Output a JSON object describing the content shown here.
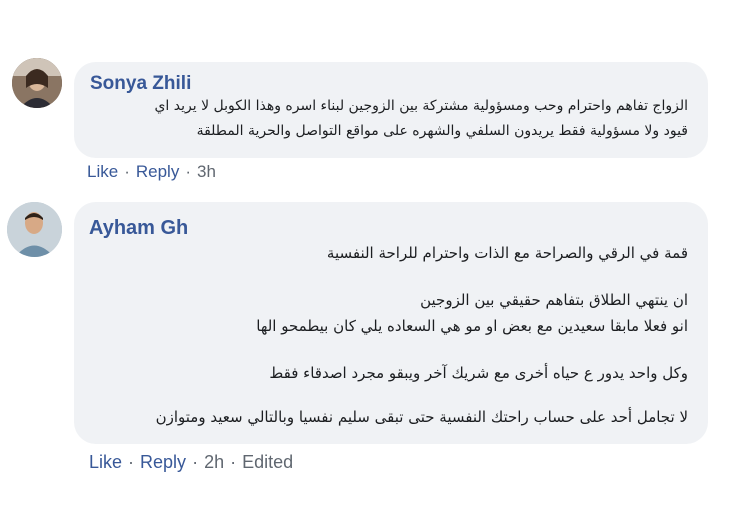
{
  "comments": [
    {
      "author": "Sonya Zhili",
      "text_lines": [
        "الزواج تفاهم واحترام وحب ومسؤولية مشتركة بين الزوجين لبناء اسره وهذا الكوبل لا يريد اي",
        "قيود ولا مسؤولية فقط يريدون السلفي والشهره على مواقع التواصل والحرية المطلقة"
      ],
      "actions": {
        "like": "Like",
        "reply": "Reply",
        "time": "3h",
        "edited": ""
      }
    },
    {
      "author": "Ayham Gh",
      "text_lines": [
        "قمة في الرقي والصراحة مع الذات واحترام للراحة النفسية",
        "ان ينتهي الطلاق بتفاهم حقيقي بين الزوجين",
        "انو فعلا مابقا سعيدين مع بعض او مو هي السعاده يلي كان بيطمحو الها",
        "وكل واحد يدور ع حياه أخرى مع شريك آخر ويبقو مجرد اصدقاء فقط",
        "لا تجامل أحد على حساب راحتك النفسية حتى تبقى سليم نفسيا وبالتالي سعيد ومتوازن"
      ],
      "actions": {
        "like": "Like",
        "reply": "Reply",
        "time": "2h",
        "edited": "Edited"
      }
    }
  ]
}
